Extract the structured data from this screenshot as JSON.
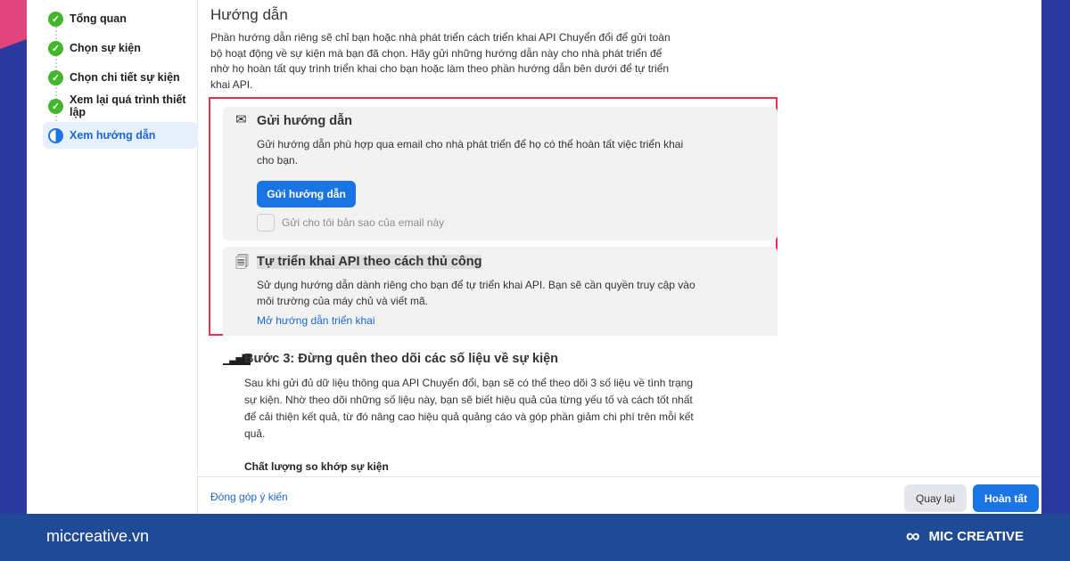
{
  "sidebar": {
    "steps": [
      {
        "label": "Tổng quan",
        "status": "done"
      },
      {
        "label": "Chọn sự kiện",
        "status": "done"
      },
      {
        "label": "Chọn chi tiết sự kiện",
        "status": "done"
      },
      {
        "label": "Xem lại quá trình thiết lập",
        "status": "done"
      },
      {
        "label": "Xem hướng dẫn",
        "status": "active"
      }
    ]
  },
  "main": {
    "title": "Hướng dẫn",
    "intro": "Phần hướng dẫn riêng sẽ chỉ bạn hoặc nhà phát triển cách triển khai API Chuyển đổi để gửi toàn bộ hoạt động về sự kiện mà bạn đã chọn. Hãy gửi những hướng dẫn này cho nhà phát triển để nhờ họ hoàn tất quy trình triển khai cho bạn hoặc làm theo phần hướng dẫn bên dưới để tự triển khai API.",
    "send_card": {
      "title": "Gửi hướng dẫn",
      "text": "Gửi hướng dẫn phù hợp qua email cho nhà phát triển để họ có thể hoàn tất việc triển khai cho bạn.",
      "button": "Gửi hướng dẫn",
      "checkbox_label": "Gửi cho tôi bản sao của email này",
      "checked": false
    },
    "manual_card": {
      "title": "Tự triển khai API theo cách thủ công",
      "text": "Sử dụng hướng dẫn dành riêng cho bạn để tự triển khai API. Bạn sẽ cần quyền truy cập vào môi trường của máy chủ và viết mã.",
      "link": "Mở hướng dẫn triển khai"
    },
    "step3": {
      "title": "Bước 3: Đừng quên theo dõi các số liệu về sự kiện",
      "text": "Sau khi gửi đủ dữ liệu thông qua API Chuyển đổi, bạn sẽ có thể theo dõi 3 số liệu về tình trạng sự kiện. Nhờ theo dõi những số liệu này, bạn sẽ biết hiệu quả của từng yếu tố và cách tốt nhất để cải thiện kết quả, từ đó nâng cao hiệu quả quảng cáo và góp phần giảm chi phí trên mỗi kết quả.",
      "subheading": "Chất lượng so khớp sự kiện"
    }
  },
  "footer": {
    "feedback": "Đóng góp ý kiến",
    "back": "Quay lại",
    "done": "Hoàn tất"
  },
  "band": {
    "site": "miccreative.vn",
    "brand": "MIC CREATIVE"
  },
  "colors": {
    "accent": "#1b74e4",
    "highlight": "#e0344e",
    "success": "#42b72a",
    "band": "#1f4a96"
  }
}
